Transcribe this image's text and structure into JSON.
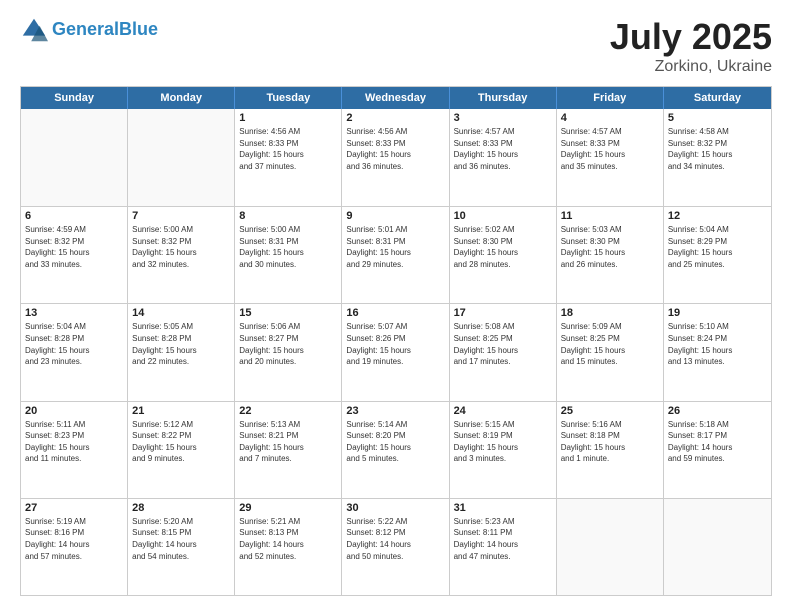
{
  "header": {
    "logo_line1": "General",
    "logo_line2": "Blue",
    "month_year": "July 2025",
    "location": "Zorkino, Ukraine"
  },
  "days_of_week": [
    "Sunday",
    "Monday",
    "Tuesday",
    "Wednesday",
    "Thursday",
    "Friday",
    "Saturday"
  ],
  "weeks": [
    [
      {
        "day": "",
        "info": ""
      },
      {
        "day": "",
        "info": ""
      },
      {
        "day": "1",
        "info": "Sunrise: 4:56 AM\nSunset: 8:33 PM\nDaylight: 15 hours\nand 37 minutes."
      },
      {
        "day": "2",
        "info": "Sunrise: 4:56 AM\nSunset: 8:33 PM\nDaylight: 15 hours\nand 36 minutes."
      },
      {
        "day": "3",
        "info": "Sunrise: 4:57 AM\nSunset: 8:33 PM\nDaylight: 15 hours\nand 36 minutes."
      },
      {
        "day": "4",
        "info": "Sunrise: 4:57 AM\nSunset: 8:33 PM\nDaylight: 15 hours\nand 35 minutes."
      },
      {
        "day": "5",
        "info": "Sunrise: 4:58 AM\nSunset: 8:32 PM\nDaylight: 15 hours\nand 34 minutes."
      }
    ],
    [
      {
        "day": "6",
        "info": "Sunrise: 4:59 AM\nSunset: 8:32 PM\nDaylight: 15 hours\nand 33 minutes."
      },
      {
        "day": "7",
        "info": "Sunrise: 5:00 AM\nSunset: 8:32 PM\nDaylight: 15 hours\nand 32 minutes."
      },
      {
        "day": "8",
        "info": "Sunrise: 5:00 AM\nSunset: 8:31 PM\nDaylight: 15 hours\nand 30 minutes."
      },
      {
        "day": "9",
        "info": "Sunrise: 5:01 AM\nSunset: 8:31 PM\nDaylight: 15 hours\nand 29 minutes."
      },
      {
        "day": "10",
        "info": "Sunrise: 5:02 AM\nSunset: 8:30 PM\nDaylight: 15 hours\nand 28 minutes."
      },
      {
        "day": "11",
        "info": "Sunrise: 5:03 AM\nSunset: 8:30 PM\nDaylight: 15 hours\nand 26 minutes."
      },
      {
        "day": "12",
        "info": "Sunrise: 5:04 AM\nSunset: 8:29 PM\nDaylight: 15 hours\nand 25 minutes."
      }
    ],
    [
      {
        "day": "13",
        "info": "Sunrise: 5:04 AM\nSunset: 8:28 PM\nDaylight: 15 hours\nand 23 minutes."
      },
      {
        "day": "14",
        "info": "Sunrise: 5:05 AM\nSunset: 8:28 PM\nDaylight: 15 hours\nand 22 minutes."
      },
      {
        "day": "15",
        "info": "Sunrise: 5:06 AM\nSunset: 8:27 PM\nDaylight: 15 hours\nand 20 minutes."
      },
      {
        "day": "16",
        "info": "Sunrise: 5:07 AM\nSunset: 8:26 PM\nDaylight: 15 hours\nand 19 minutes."
      },
      {
        "day": "17",
        "info": "Sunrise: 5:08 AM\nSunset: 8:25 PM\nDaylight: 15 hours\nand 17 minutes."
      },
      {
        "day": "18",
        "info": "Sunrise: 5:09 AM\nSunset: 8:25 PM\nDaylight: 15 hours\nand 15 minutes."
      },
      {
        "day": "19",
        "info": "Sunrise: 5:10 AM\nSunset: 8:24 PM\nDaylight: 15 hours\nand 13 minutes."
      }
    ],
    [
      {
        "day": "20",
        "info": "Sunrise: 5:11 AM\nSunset: 8:23 PM\nDaylight: 15 hours\nand 11 minutes."
      },
      {
        "day": "21",
        "info": "Sunrise: 5:12 AM\nSunset: 8:22 PM\nDaylight: 15 hours\nand 9 minutes."
      },
      {
        "day": "22",
        "info": "Sunrise: 5:13 AM\nSunset: 8:21 PM\nDaylight: 15 hours\nand 7 minutes."
      },
      {
        "day": "23",
        "info": "Sunrise: 5:14 AM\nSunset: 8:20 PM\nDaylight: 15 hours\nand 5 minutes."
      },
      {
        "day": "24",
        "info": "Sunrise: 5:15 AM\nSunset: 8:19 PM\nDaylight: 15 hours\nand 3 minutes."
      },
      {
        "day": "25",
        "info": "Sunrise: 5:16 AM\nSunset: 8:18 PM\nDaylight: 15 hours\nand 1 minute."
      },
      {
        "day": "26",
        "info": "Sunrise: 5:18 AM\nSunset: 8:17 PM\nDaylight: 14 hours\nand 59 minutes."
      }
    ],
    [
      {
        "day": "27",
        "info": "Sunrise: 5:19 AM\nSunset: 8:16 PM\nDaylight: 14 hours\nand 57 minutes."
      },
      {
        "day": "28",
        "info": "Sunrise: 5:20 AM\nSunset: 8:15 PM\nDaylight: 14 hours\nand 54 minutes."
      },
      {
        "day": "29",
        "info": "Sunrise: 5:21 AM\nSunset: 8:13 PM\nDaylight: 14 hours\nand 52 minutes."
      },
      {
        "day": "30",
        "info": "Sunrise: 5:22 AM\nSunset: 8:12 PM\nDaylight: 14 hours\nand 50 minutes."
      },
      {
        "day": "31",
        "info": "Sunrise: 5:23 AM\nSunset: 8:11 PM\nDaylight: 14 hours\nand 47 minutes."
      },
      {
        "day": "",
        "info": ""
      },
      {
        "day": "",
        "info": ""
      }
    ]
  ]
}
